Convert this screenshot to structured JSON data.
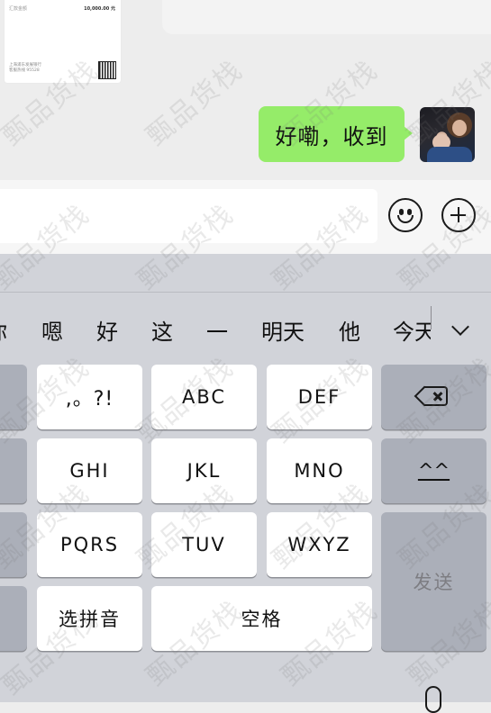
{
  "receipt": {
    "label": "汇款金额",
    "amount": "10,000.00 元",
    "bank_line1": "上海浦东发展银行",
    "bank_line2": "客服热线 95528"
  },
  "chat": {
    "sent_message": "好嘞，收到"
  },
  "input": {
    "value": ""
  },
  "keyboard": {
    "candidates": [
      "你",
      "嗯",
      "好",
      "这",
      "一",
      "明天",
      "他",
      "今天"
    ],
    "keys": {
      "punct": ",。?!",
      "abc": "ABC",
      "def": "DEF",
      "ghi": "GHI",
      "jkl": "JKL",
      "mno": "MNO",
      "pqrs": "PQRS",
      "tuv": "TUV",
      "wxyz": "WXYZ",
      "emoticon": "^^",
      "send": "发送",
      "select_pinyin": "选拼音",
      "space": "空格"
    }
  },
  "watermark": {
    "text": "甄品货栈"
  }
}
